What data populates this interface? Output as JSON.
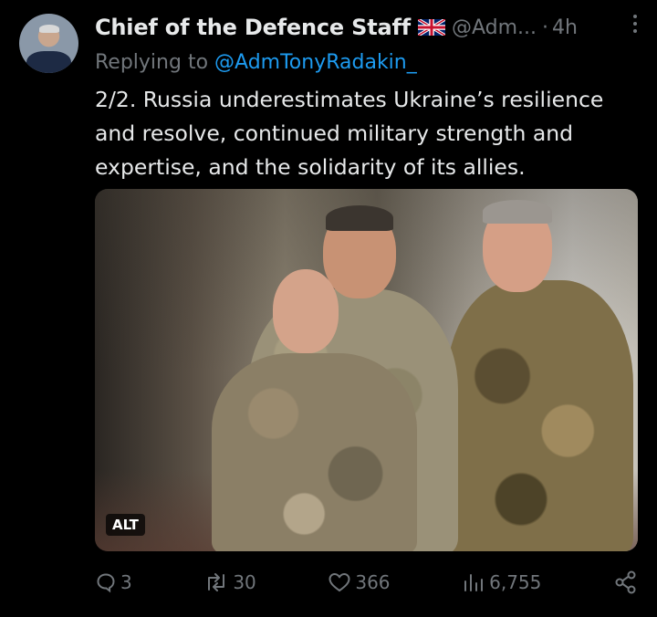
{
  "tweet": {
    "author_name": "Chief of the Defence Staff",
    "flag": "uk-flag-icon",
    "handle": "@Adm...",
    "separator": "·",
    "time": "4h",
    "replying_prefix": "Replying to",
    "replying_to": "@AdmTonyRadakin_",
    "text": "2/2. Russia underestimates Ukraine’s resilience and resolve, continued military strength and expertise, and the solidarity of its allies.",
    "media": {
      "alt_label": "ALT"
    }
  },
  "actions": {
    "replies": "3",
    "retweets": "30",
    "likes": "366",
    "views": "6,755"
  },
  "colors": {
    "background": "#000000",
    "text": "#e7e9ea",
    "secondary": "#71767b",
    "link": "#1d9bf0"
  }
}
